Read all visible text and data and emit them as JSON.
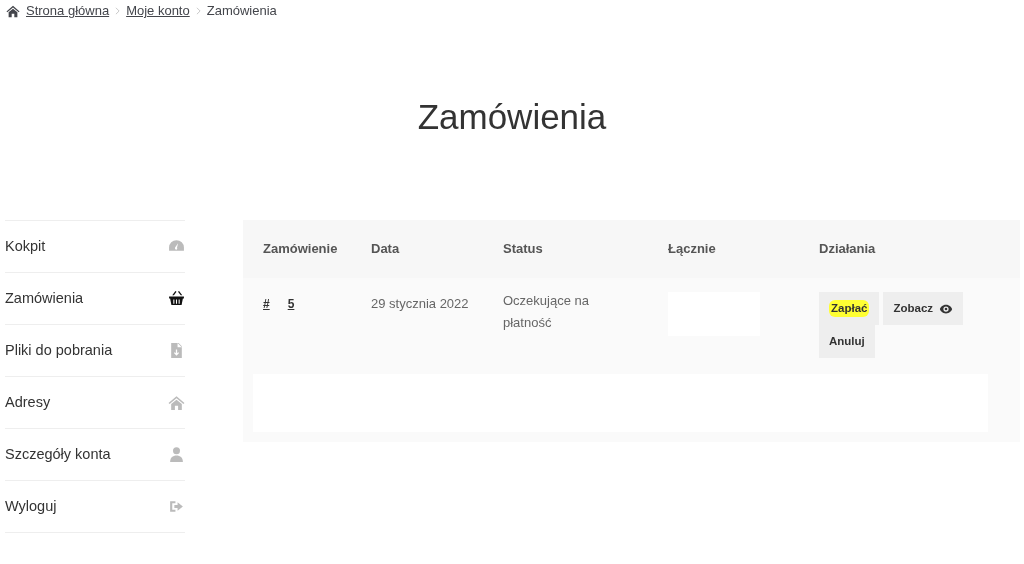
{
  "breadcrumb": [
    {
      "label": "Strona główna",
      "link": true
    },
    {
      "label": "Moje konto",
      "link": true
    },
    {
      "label": "Zamówienia",
      "link": false
    }
  ],
  "title": "Zamówienia",
  "sidebar": {
    "items": [
      {
        "label": "Kokpit",
        "selected": false
      },
      {
        "label": "Zamówienia",
        "selected": true
      },
      {
        "label": "Pliki do pobrania",
        "selected": false
      },
      {
        "label": "Adresy",
        "selected": false
      },
      {
        "label": "Szczegóły konta",
        "selected": false
      },
      {
        "label": "Wyloguj",
        "selected": false
      }
    ]
  },
  "table": {
    "columns": [
      "Zamówienie",
      "Data",
      "Status",
      "Łącznie",
      "Działania"
    ],
    "rows": [
      {
        "order_prefix": "#",
        "order_suffix": "5",
        "date": "29 stycznia 2022",
        "status": "Oczekujące na płatność",
        "actions": [
          {
            "label": "Zapłać",
            "highlighted": true
          },
          {
            "label": "Zobacz",
            "highlighted": false
          },
          {
            "label": "Anuluj",
            "highlighted": false
          }
        ]
      }
    ]
  }
}
